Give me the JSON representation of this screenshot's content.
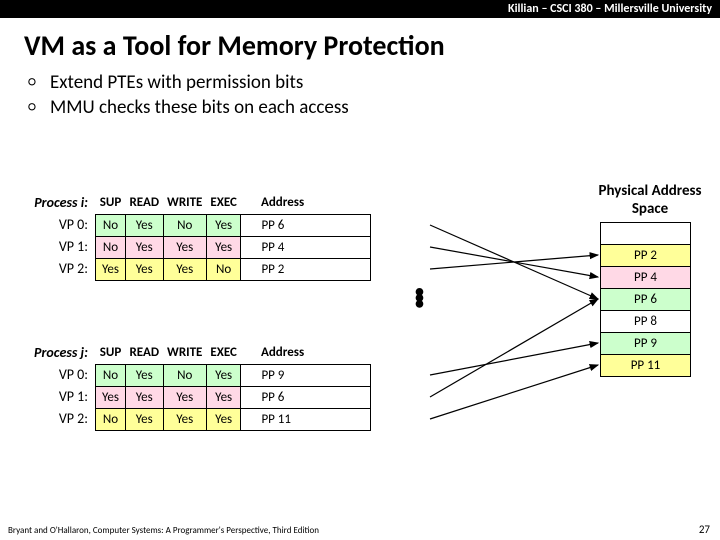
{
  "header": "Killian – CSCI 380 – Millersville University",
  "title": "VM as a Tool for Memory Protection",
  "bullets": [
    "Extend PTEs with permission bits",
    "MMU checks these bits on each access"
  ],
  "table_headers": {
    "sup": "SUP",
    "read": "READ",
    "write": "WRITE",
    "exec": "EXEC",
    "addr": "Address"
  },
  "proc_i": {
    "name": "Process i:",
    "rows": [
      {
        "label": "VP 0:",
        "sup": "No",
        "read": "Yes",
        "write": "No",
        "exec": "Yes",
        "addr": "PP 6"
      },
      {
        "label": "VP 1:",
        "sup": "No",
        "read": "Yes",
        "write": "Yes",
        "exec": "Yes",
        "addr": "PP 4"
      },
      {
        "label": "VP 2:",
        "sup": "Yes",
        "read": "Yes",
        "write": "Yes",
        "exec": "No",
        "addr": "PP 2"
      }
    ]
  },
  "proc_j": {
    "name": "Process j:",
    "rows": [
      {
        "label": "VP 0:",
        "sup": "No",
        "read": "Yes",
        "write": "No",
        "exec": "Yes",
        "addr": "PP 9"
      },
      {
        "label": "VP 1:",
        "sup": "Yes",
        "read": "Yes",
        "write": "Yes",
        "exec": "Yes",
        "addr": "PP 6"
      },
      {
        "label": "VP 2:",
        "sup": "No",
        "read": "Yes",
        "write": "Yes",
        "exec": "Yes",
        "addr": "PP 11"
      }
    ]
  },
  "phys_label": "Physical Address Space",
  "phys_pages": [
    "",
    "PP 2",
    "PP 4",
    "PP 6",
    "PP 8",
    "PP 9",
    "PP 11"
  ],
  "footer": "Bryant and O'Hallaron, Computer Systems: A Programmer's Perspective, Third Edition",
  "page": "27"
}
